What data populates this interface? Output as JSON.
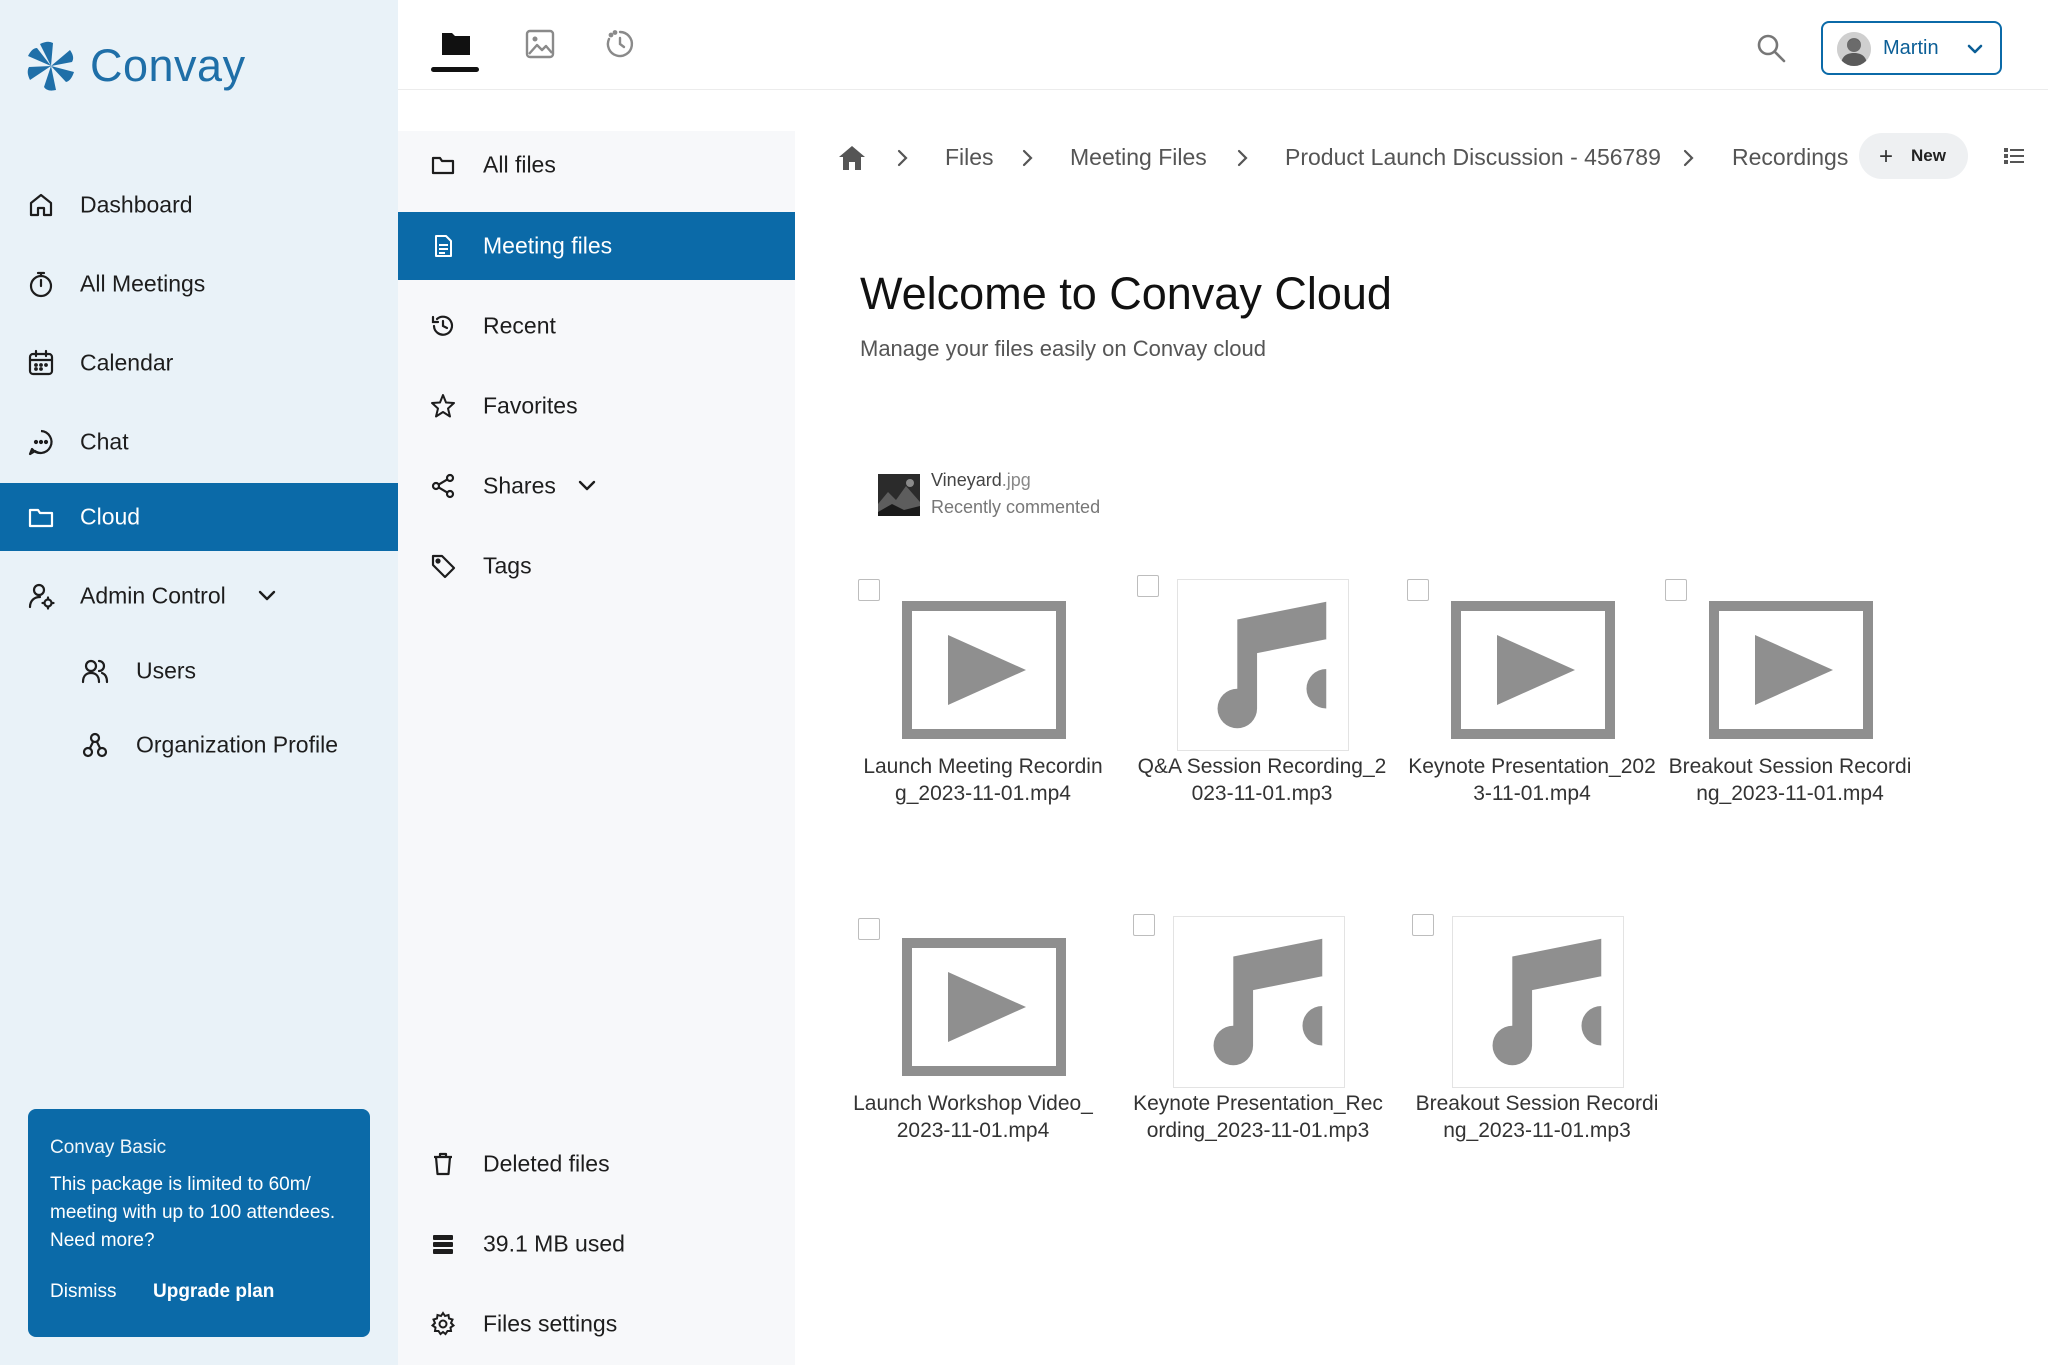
{
  "app": {
    "name": "Convay"
  },
  "sidebar": {
    "items": [
      {
        "label": "Dashboard",
        "icon": "home-icon"
      },
      {
        "label": "All Meetings",
        "icon": "stopwatch-icon"
      },
      {
        "label": "Calendar",
        "icon": "calendar-icon"
      },
      {
        "label": "Chat",
        "icon": "chat-icon"
      },
      {
        "label": "Cloud",
        "icon": "folder-icon",
        "active": true
      },
      {
        "label": "Admin Control",
        "icon": "admin-user-icon",
        "expanded": true
      },
      {
        "label": "Users",
        "icon": "users-icon"
      },
      {
        "label": "Organization Profile",
        "icon": "organization-icon"
      }
    ],
    "plan": {
      "title": "Convay Basic",
      "description": "This package is limited to 60m/ meeting with up to 100 attendees. Need more?",
      "dismiss": "Dismiss",
      "upgrade": "Upgrade plan"
    }
  },
  "topbar": {
    "apps": [
      {
        "name": "files",
        "icon": "folder-icon",
        "active": true
      },
      {
        "name": "photos",
        "icon": "image-icon"
      },
      {
        "name": "activity",
        "icon": "activity-icon"
      }
    ],
    "user": {
      "name": "Martin"
    }
  },
  "files_nav": {
    "items": [
      {
        "label": "All files",
        "icon": "folder-icon"
      },
      {
        "label": "Meeting files",
        "icon": "meeting-files-icon",
        "active": true
      },
      {
        "label": "Recent",
        "icon": "history-icon"
      },
      {
        "label": "Favorites",
        "icon": "star-icon"
      },
      {
        "label": "Shares",
        "icon": "share-icon"
      },
      {
        "label": "Tags",
        "icon": "tag-icon"
      }
    ],
    "bottom": [
      {
        "label": "Deleted files",
        "icon": "trash-icon"
      },
      {
        "label": "39.1 MB used",
        "icon": "storage-icon"
      },
      {
        "label": "Files settings",
        "icon": "gear-icon"
      }
    ]
  },
  "breadcrumb": [
    "Files",
    "Meeting Files",
    "Product Launch Discussion - 456789",
    "Recordings"
  ],
  "toolbar": {
    "new_label": "New"
  },
  "main": {
    "title": "Welcome to Convay Cloud",
    "subtitle": "Manage your files easily on Convay cloud",
    "recent": {
      "name": "Vineyard",
      "ext": ".jpg",
      "note": "Recently commented"
    },
    "files": [
      {
        "name": "Launch Meeting Recording_2023-11-01.mp4",
        "type": "video"
      },
      {
        "name": "Q&A Session Recording_2023-11-01.mp3",
        "type": "audio"
      },
      {
        "name": "Keynote Presentation_2023-11-01.mp4",
        "type": "video"
      },
      {
        "name": "Breakout Session Recording_2023-11-01.mp4",
        "type": "video"
      },
      {
        "name": "Launch Workshop Video_2023-11-01.mp4",
        "type": "video"
      },
      {
        "name": "Keynote Presentation_Recording_2023-11-01.mp3",
        "type": "audio"
      },
      {
        "name": "Breakout Session Recording_2023-11-01.mp3",
        "type": "audio"
      }
    ]
  },
  "colors": {
    "accent": "#0b6aa8",
    "sidebar_bg": "#e9f2f8",
    "icon_gray": "#8f8f8f"
  }
}
